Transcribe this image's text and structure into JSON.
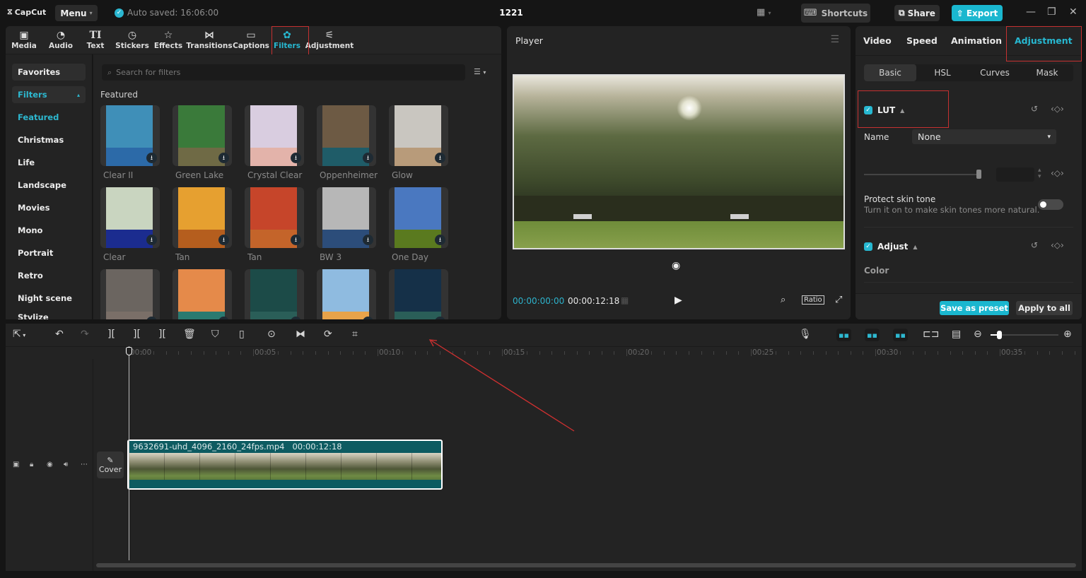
{
  "titlebar": {
    "app_name": "CapCut",
    "menu_label": "Menu",
    "autosave": "Auto saved: 16:06:00",
    "project_title": "1221",
    "shortcuts_label": "Shortcuts",
    "share_label": "Share",
    "export_label": "Export"
  },
  "media_toolbar": {
    "items": [
      {
        "label": "Media",
        "icon": "media-icon"
      },
      {
        "label": "Audio",
        "icon": "audio-icon"
      },
      {
        "label": "Text",
        "icon": "text-icon"
      },
      {
        "label": "Stickers",
        "icon": "stickers-icon"
      },
      {
        "label": "Effects",
        "icon": "effects-icon"
      },
      {
        "label": "Transitions",
        "icon": "transitions-icon"
      },
      {
        "label": "Captions",
        "icon": "captions-icon"
      },
      {
        "label": "Filters",
        "icon": "filters-icon",
        "active": true
      },
      {
        "label": "Adjustment",
        "icon": "adjustment-icon"
      }
    ]
  },
  "filter_categories": [
    {
      "label": "Favorites"
    },
    {
      "label": "Filters",
      "expanded": true
    },
    {
      "label": "Featured",
      "active": true
    },
    {
      "label": "Christmas"
    },
    {
      "label": "Life"
    },
    {
      "label": "Landscape"
    },
    {
      "label": "Movies"
    },
    {
      "label": "Mono"
    },
    {
      "label": "Portrait"
    },
    {
      "label": "Retro"
    },
    {
      "label": "Night scene"
    },
    {
      "label": "Stylize"
    }
  ],
  "filter_panel": {
    "search_placeholder": "Search for filters",
    "section_title": "Featured",
    "filters": [
      {
        "name": "Clear II",
        "img": "#3f8fb8",
        "swatch": "#2c6aa8"
      },
      {
        "name": "Green Lake",
        "img": "#3a7a3a",
        "swatch": "#6f6a45"
      },
      {
        "name": "Crystal Clear",
        "img": "#d9cde0",
        "swatch": "#e3b3aa"
      },
      {
        "name": "Oppenheimer",
        "img": "#6d5a44",
        "swatch": "#1f5c68"
      },
      {
        "name": "Glow",
        "img": "#c9c6c0",
        "swatch": "#b89b7a"
      },
      {
        "name": "Clear",
        "img": "#c9d5c0",
        "swatch": "#1b2c8f"
      },
      {
        "name": "Tan",
        "img": "#e6a030",
        "swatch": "#b55e1e"
      },
      {
        "name": "Tan",
        "img": "#c6452a",
        "swatch": "#c4642a"
      },
      {
        "name": "BW 3",
        "img": "#b7b7b7",
        "swatch": "#2c4d7a"
      },
      {
        "name": "One Day",
        "img": "#4a78c0",
        "swatch": "#5a7a1f"
      },
      {
        "name": "",
        "img": "#6b6560",
        "swatch": "#7a6f68"
      },
      {
        "name": "",
        "img": "#e58a4a",
        "swatch": "#2a7a70"
      },
      {
        "name": "",
        "img": "#1c4b48",
        "swatch": "#2a5e58"
      },
      {
        "name": "",
        "img": "#8fbbe0",
        "swatch": "#e8a34a"
      },
      {
        "name": "",
        "img": "#153048",
        "swatch": "#2a5e58"
      }
    ]
  },
  "player": {
    "title": "Player",
    "current_time": "00:00:00:00",
    "total_time": "00:00:12:18",
    "ratio_label": "Ratio"
  },
  "right_panel": {
    "tabs": [
      {
        "label": "Video"
      },
      {
        "label": "Speed"
      },
      {
        "label": "Animation"
      },
      {
        "label": "Adjustment",
        "active": true
      }
    ],
    "subtabs": [
      {
        "label": "Basic",
        "active": true
      },
      {
        "label": "HSL"
      },
      {
        "label": "Curves"
      },
      {
        "label": "Mask"
      }
    ],
    "lut": {
      "title": "LUT",
      "checked": true,
      "name_label": "Name",
      "name_value": "None",
      "intensity_fraction": 1.0
    },
    "protect_skin": {
      "title": "Protect skin tone",
      "subtitle": "Turn it on to make skin tones more natural.",
      "enabled": false
    },
    "adjust": {
      "title": "Adjust",
      "checked": true,
      "color_label": "Color"
    },
    "save_preset_label": "Save as preset",
    "apply_all_label": "Apply to all"
  },
  "timeline": {
    "ruler_labels": [
      "00:00",
      "00:05",
      "00:10",
      "00:15",
      "00:20",
      "00:25",
      "00:30",
      "00:35"
    ],
    "cover_label": "Cover",
    "clip": {
      "filename": "9632691-uhd_4096_2160_24fps.mp4",
      "duration": "00:00:12:18"
    },
    "zoom_level_fraction": 0.12
  },
  "colors": {
    "accent": "#1ab7cf",
    "highlight_box": "#c53131",
    "clip_bg": "#0d5b61"
  }
}
